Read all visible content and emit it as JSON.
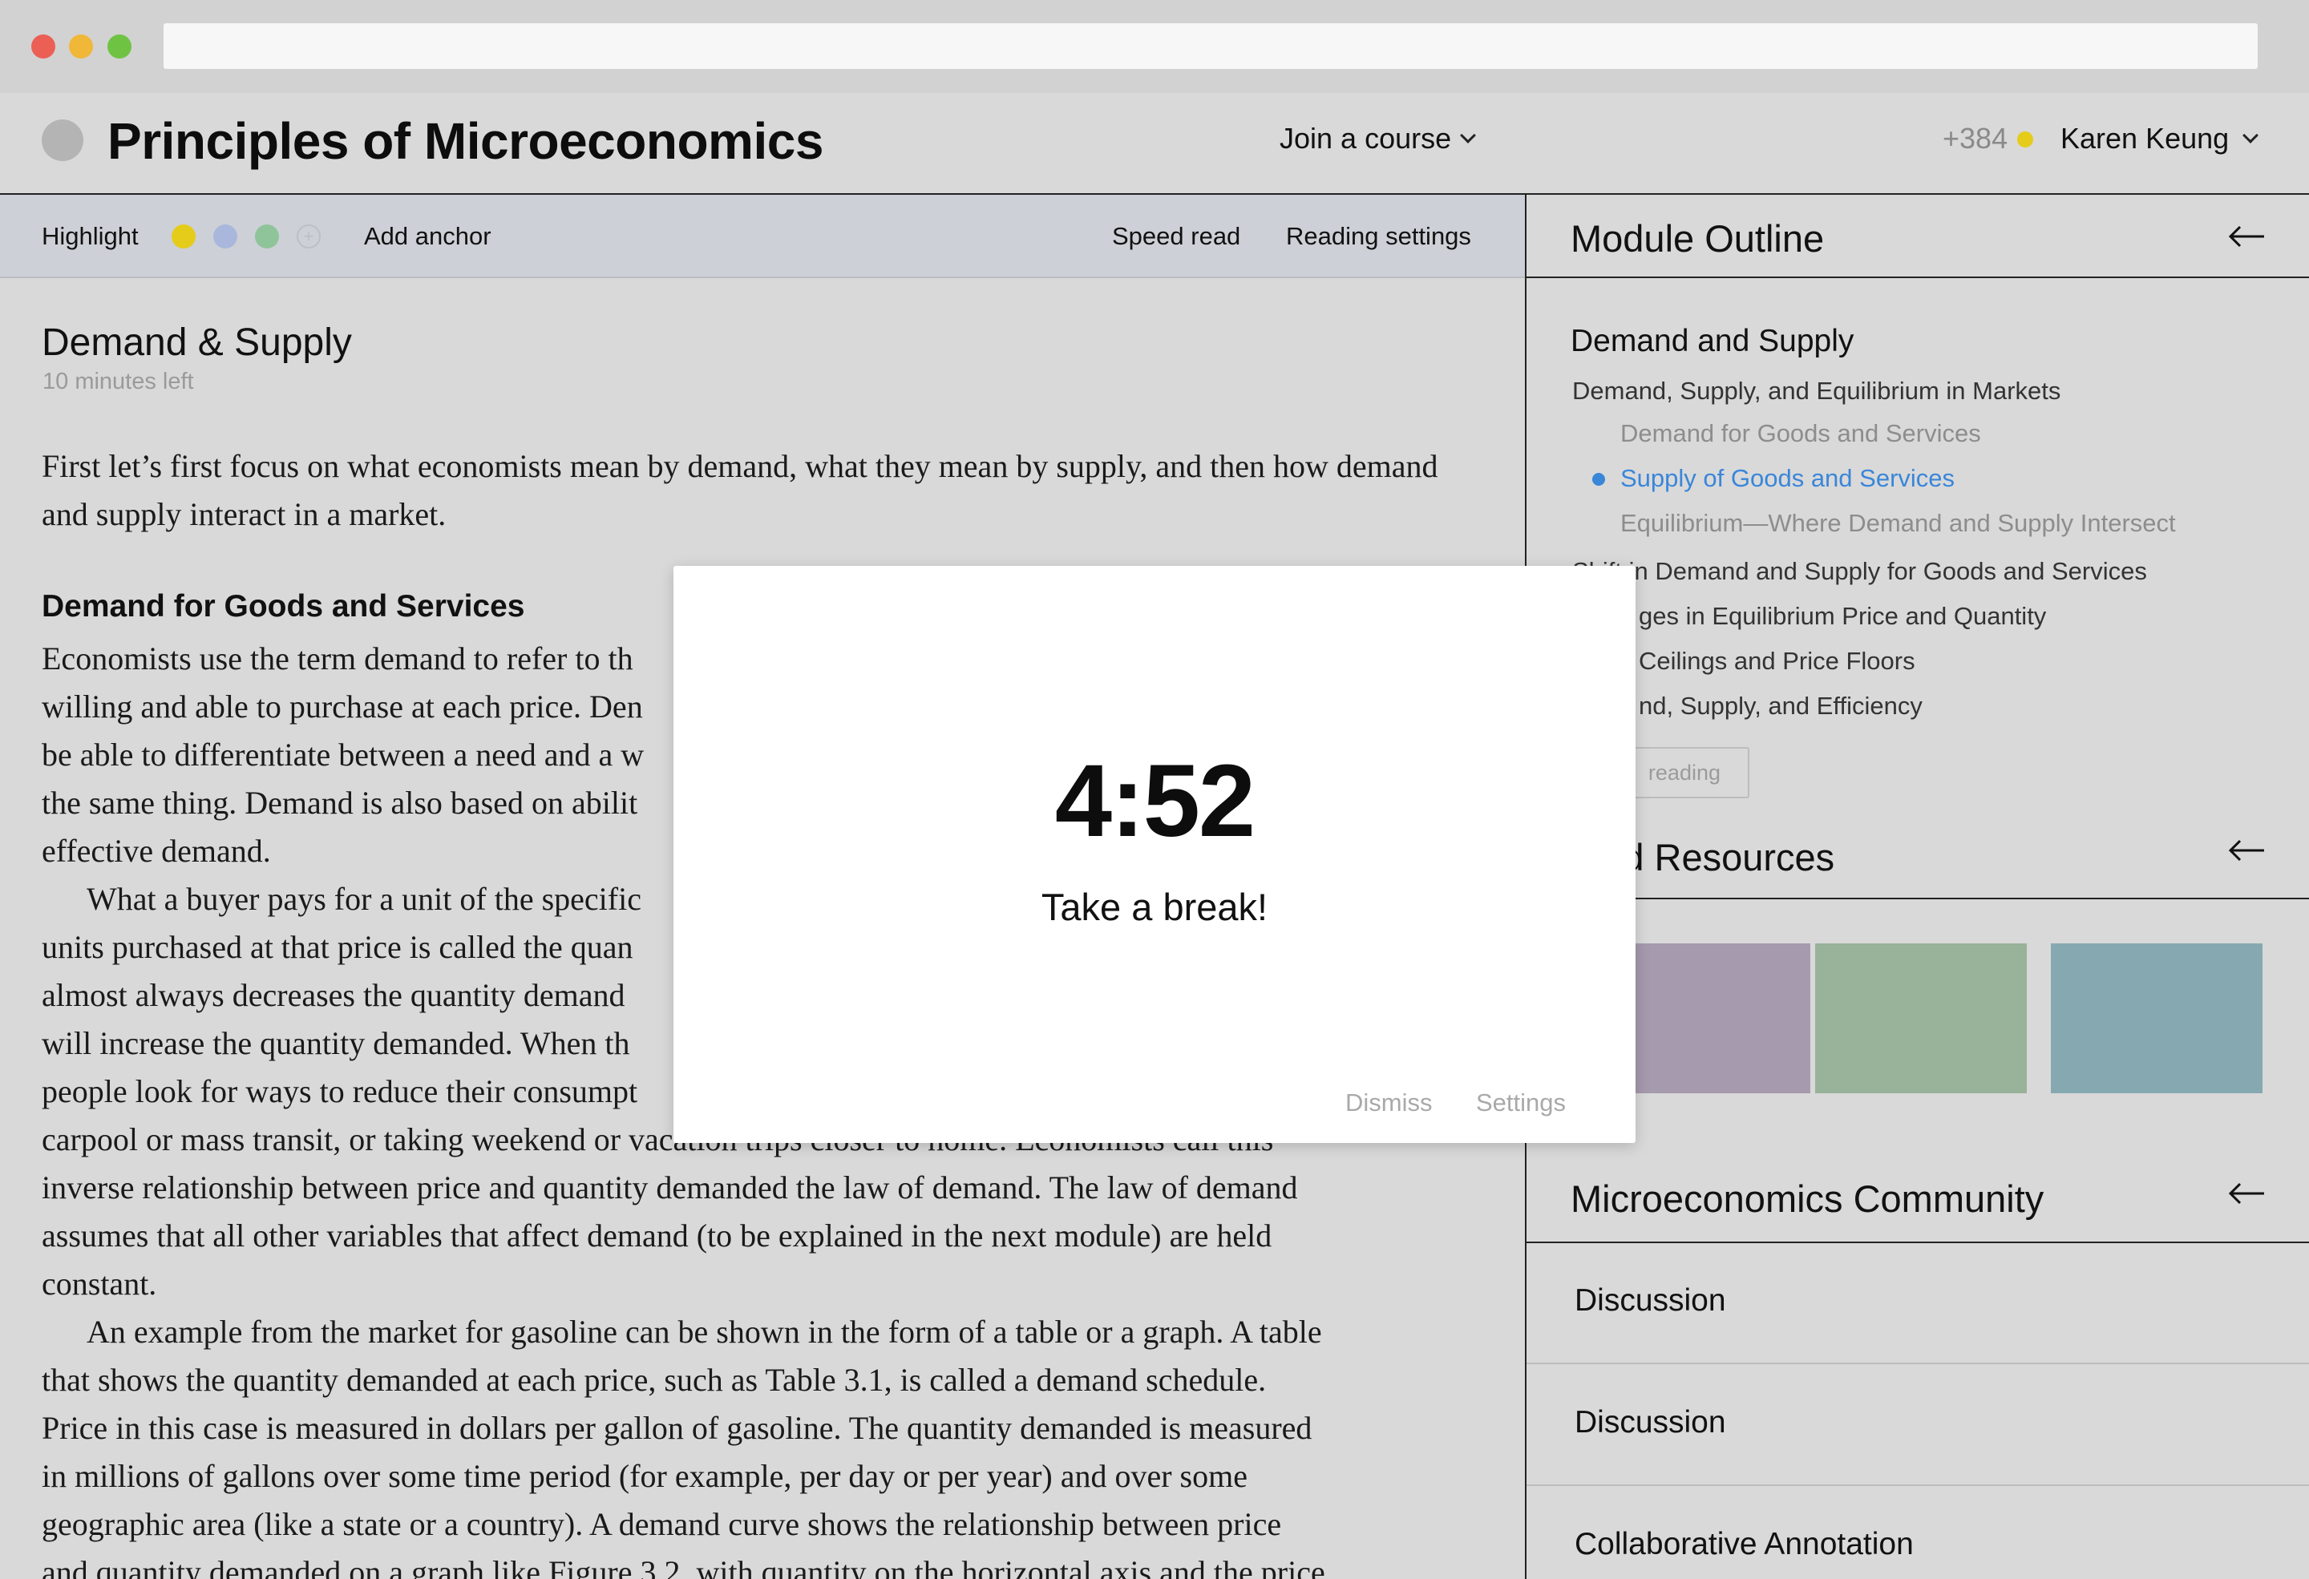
{
  "header": {
    "course_title": "Principles of Microeconomics",
    "join_course": "Join a course",
    "points": "+384",
    "user_name": "Karen Keung"
  },
  "toolbar": {
    "highlight_label": "Highlight",
    "highlight_colors": [
      "#e5cc1a",
      "#a9b7dc",
      "#8fc49a"
    ],
    "add_color_icon": "plus-icon",
    "add_anchor": "Add anchor",
    "speed_read": "Speed read",
    "reading_settings": "Reading settings"
  },
  "reading": {
    "section_title": "Demand & Supply",
    "time_left": "10 minutes left",
    "intro": "First let’s first focus on what economists mean by demand, what they mean by supply, and then how demand and supply interact in a market.",
    "sub_heading": "Demand for Goods and Services",
    "lines": [
      "Economists use the term demand to refer to th",
      "willing and able to purchase at each price. Den",
      "be able to differentiate between a need and a w",
      "the same thing. Demand is also based on abilit",
      "effective demand.",
      "What a buyer pays for a unit of the specific",
      "units purchased at that price is called the quan",
      "almost always decreases the quantity demand",
      "will increase the quantity demanded. When th",
      "people look for ways to reduce their consumpt",
      "carpool or mass transit, or taking weekend or vacation trips closer to home. Economists call this",
      "inverse relationship between price and quantity demanded the law of demand. The law of demand",
      "assumes that all other variables that affect demand (to be explained in the next module) are held",
      "constant.",
      "An example from the market for gasoline can be shown in the form of a table or a graph. A table",
      "that shows the quantity demanded at each price, such as Table 3.1, is called a demand schedule.",
      "Price in this case is measured in dollars per gallon of gasoline. The quantity demanded is measured",
      "in millions of gallons over some time period (for example, per day or per year) and over some",
      "geographic area (like a state or a country). A demand curve shows the relationship between price",
      "and quantity demanded on a graph like Figure 3.2, with quantity on the horizontal axis and the price"
    ]
  },
  "sidebar": {
    "module_outline": "Module Outline",
    "outline_title": "Demand and Supply",
    "outline_items": [
      "Demand, Supply, and Equilibrium in Markets",
      "Demand for Goods and Services",
      "Supply of Goods and Services",
      "Equilibrium—Where Demand and Supply Intersect",
      "Shifts in Demand and Supply for Goods and Services",
      "Changes in Equilibrium Price and Quantity",
      "Price Ceilings and Price Floors",
      "Demand, Supply, and Efficiency"
    ],
    "outline_items_visible": [
      "Demand, Supply, and Equilibrium in Markets",
      "Demand for Goods and Services",
      "Supply of Goods and Services",
      "Equilibrium—Where Demand and Supply Intersect",
      "Shift   in Demand and Supply for Goods and Services",
      "ges in Equilibrium Price and Quantity",
      "Ceilings and Price Floors",
      "nd, Supply, and Efficiency"
    ],
    "keep_reading": "reading",
    "related_resources": "ated Resources",
    "resource_colors": [
      "#a59aae",
      "#99b29a",
      "#86a9b1"
    ],
    "community_title": "Microeconomics Community",
    "community_items": [
      "Discussion",
      "Discussion",
      "Collaborative Annotation"
    ],
    "collapse_icon": "arrow-left-icon"
  },
  "modal": {
    "timer": "4:52",
    "message": "Take a break!",
    "dismiss": "Dismiss",
    "settings": "Settings"
  }
}
